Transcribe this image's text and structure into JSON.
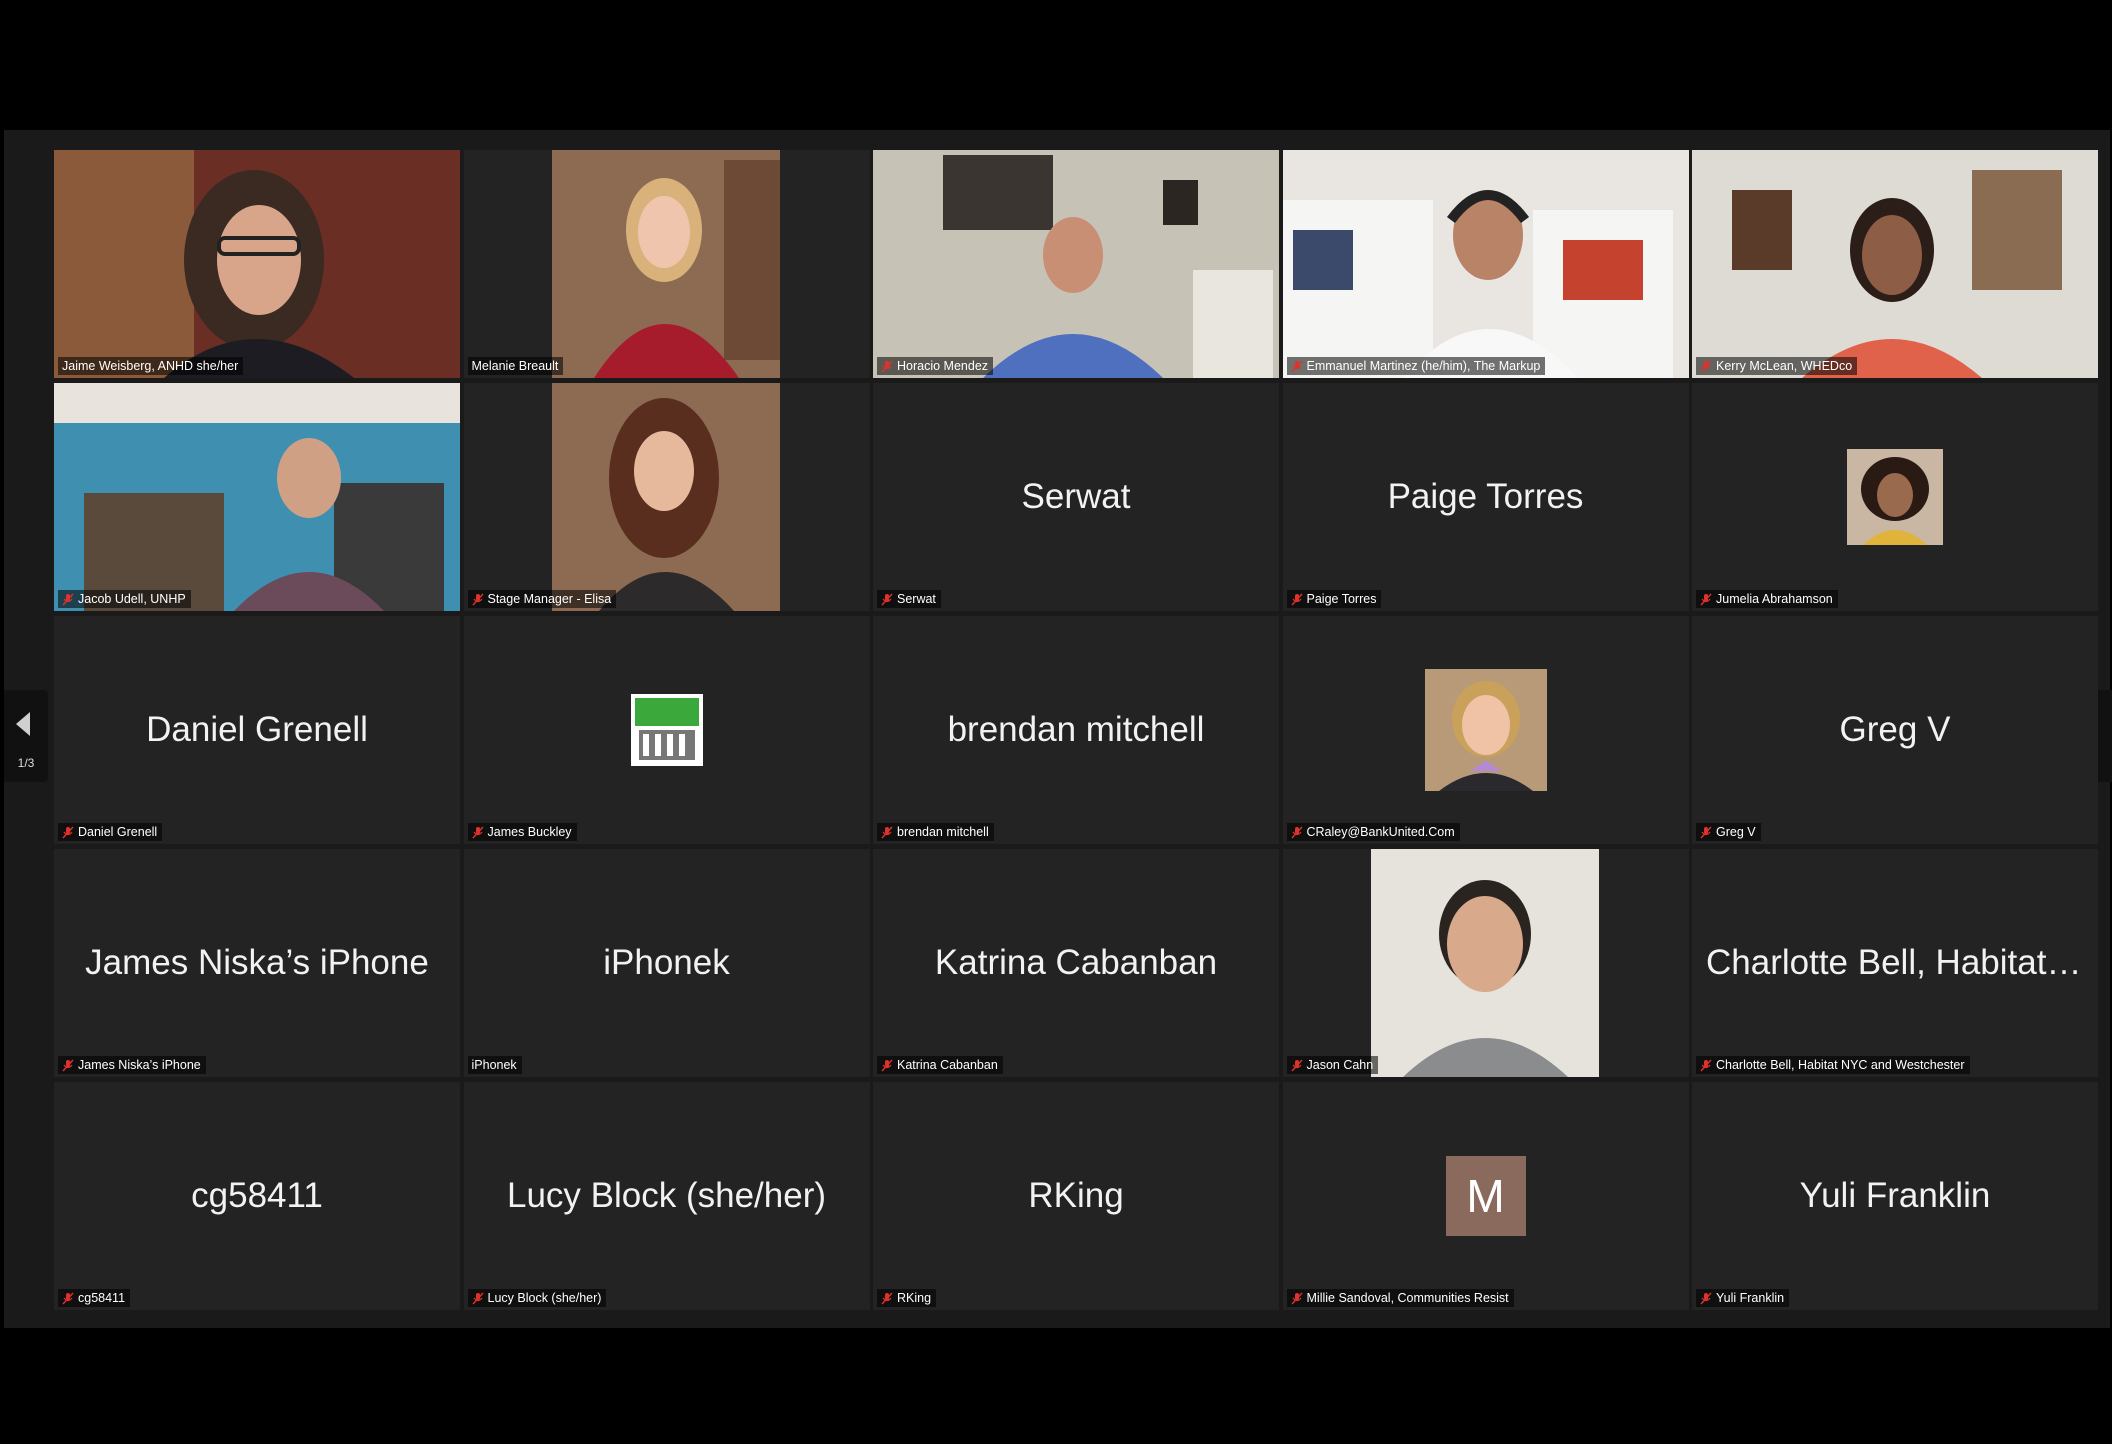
{
  "pager": {
    "count": "1/3"
  },
  "tiles": [
    {
      "display": "",
      "label": "Jaime Weisberg, ANHD she/her",
      "muted": false,
      "type": "video",
      "active": true
    },
    {
      "display": "",
      "label": "Melanie Breault",
      "muted": false,
      "type": "video"
    },
    {
      "display": "",
      "label": "Horacio Mendez",
      "muted": true,
      "type": "video"
    },
    {
      "display": "",
      "label": "Emmanuel Martinez (he/him), The Markup",
      "muted": true,
      "type": "video"
    },
    {
      "display": "",
      "label": "Kerry McLean, WHEDco",
      "muted": true,
      "type": "video"
    },
    {
      "display": "",
      "label": "Jacob Udell, UNHP",
      "muted": true,
      "type": "video"
    },
    {
      "display": "",
      "label": "Stage Manager - Elisa",
      "muted": true,
      "type": "video"
    },
    {
      "display": "Serwat",
      "label": "Serwat",
      "muted": true,
      "type": "name"
    },
    {
      "display": "Paige Torres",
      "label": "Paige Torres",
      "muted": true,
      "type": "name"
    },
    {
      "display": "",
      "label": "Jumelia Abrahamson",
      "muted": true,
      "type": "avatar"
    },
    {
      "display": "Daniel Grenell",
      "label": "Daniel Grenell",
      "muted": true,
      "type": "name"
    },
    {
      "display": "",
      "label": "James Buckley",
      "muted": true,
      "type": "avatar"
    },
    {
      "display": "brendan mitchell",
      "label": "brendan mitchell",
      "muted": true,
      "type": "name"
    },
    {
      "display": "",
      "label": "CRaley@BankUnited.Com",
      "muted": true,
      "type": "avatar"
    },
    {
      "display": "Greg V",
      "label": "Greg V",
      "muted": true,
      "type": "name"
    },
    {
      "display": "James Niska’s iPhone",
      "label": "James Niska’s iPhone",
      "muted": true,
      "type": "name"
    },
    {
      "display": "iPhonek",
      "label": "iPhonek",
      "muted": false,
      "type": "name"
    },
    {
      "display": "Katrina Cabanban",
      "label": "Katrina Cabanban",
      "muted": true,
      "type": "name"
    },
    {
      "display": "",
      "label": "Jason Cahn",
      "muted": true,
      "type": "photo"
    },
    {
      "display": "Charlotte Bell, Habitat N...",
      "label": "Charlotte Bell, Habitat NYC and Westchester",
      "muted": true,
      "type": "name"
    },
    {
      "display": "cg58411",
      "label": "cg58411",
      "muted": true,
      "type": "name"
    },
    {
      "display": "Lucy Block (she/her)",
      "label": "Lucy Block (she/her)",
      "muted": true,
      "type": "name"
    },
    {
      "display": "RKing",
      "label": "RKing",
      "muted": true,
      "type": "name"
    },
    {
      "display": "M",
      "label": "Millie Sandoval, Communities Resist",
      "muted": true,
      "type": "letter"
    },
    {
      "display": "Yuli Franklin",
      "label": "Yuli Franklin",
      "muted": true,
      "type": "name"
    }
  ],
  "colors": {
    "active_outline": "#d8e27a",
    "muted_icon": "#e0322b",
    "letter_avatar_bg": "#8a6a5c"
  },
  "icons": {
    "muted": "muted-mic-icon",
    "pager": "chevron-left-icon"
  }
}
